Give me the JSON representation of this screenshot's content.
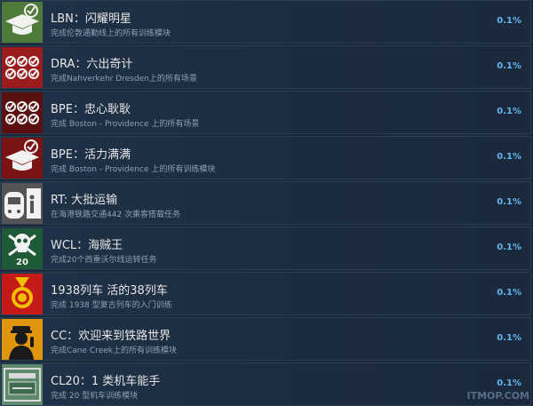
{
  "achievements": [
    {
      "title": "LBN：闪耀明星",
      "desc": "完成伦敦通勤线上的所有训练模块",
      "pct": "0.1%",
      "icon": "graduation-cap-check-icon",
      "color": "#4e7a3a"
    },
    {
      "title": "DRA：六出奇计",
      "desc": "完成Nahverkehr Dresden上的所有场景",
      "pct": "0.1%",
      "icon": "six-checks-icon",
      "color": "#9b1c1c"
    },
    {
      "title": "BPE：忠心耿耿",
      "desc": "完成 Boston - Providence 上的所有场景",
      "pct": "0.1%",
      "icon": "six-checks-icon",
      "color": "#5a1010"
    },
    {
      "title": "BPE：活力满满",
      "desc": "完成 Boston - Providence 上的所有训练模块",
      "pct": "0.1%",
      "icon": "graduation-cap-check-icon",
      "color": "#7a1414"
    },
    {
      "title": "RT: 大批运输",
      "desc": "在海港铁路交通442 次乘客搭载任务",
      "pct": "0.1%",
      "icon": "train-front-icon",
      "color": "#555555"
    },
    {
      "title": "WCL：海贼王",
      "desc": "完成20个西重沃尔线运转任务",
      "pct": "0.1%",
      "icon": "skull-crossbones-icon",
      "color": "#1f5a36",
      "badge": "20"
    },
    {
      "title": "1938列车 活的38列车",
      "desc": "完成 1938 型复古列车的入门训练",
      "pct": "0.1%",
      "icon": "medal-icon",
      "color": "#c41a1a"
    },
    {
      "title": "CC：欢迎来到铁路世界",
      "desc": "完成Cane Creek上的所有训练模块",
      "pct": "0.1%",
      "icon": "conductor-icon",
      "color": "#e0950f"
    },
    {
      "title": "CL20：1 类机车能手",
      "desc": "完成 20 型机车训练模块",
      "pct": "0.1%",
      "icon": "locomotive-plate-icon",
      "color": "#5c8a6a"
    }
  ],
  "watermark": "ITMOP.COM"
}
